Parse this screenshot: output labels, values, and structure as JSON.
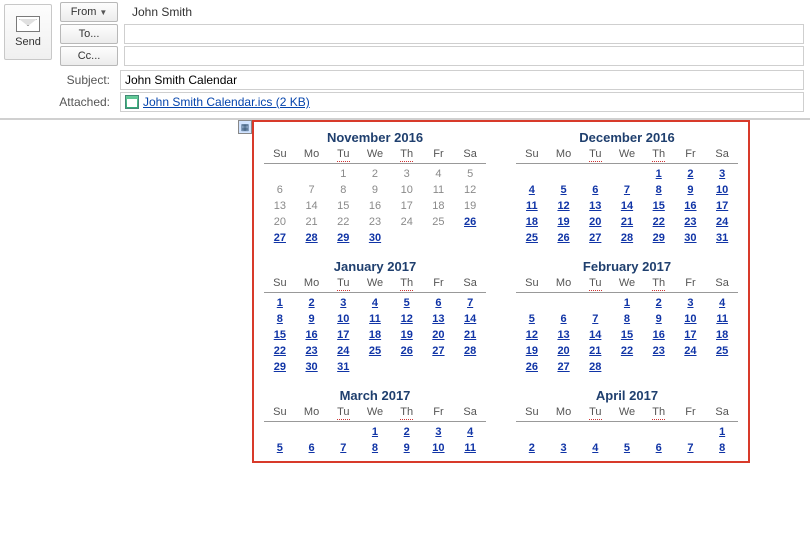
{
  "compose": {
    "send_label": "Send",
    "from_label": "From",
    "from_value": "John Smith",
    "to_label": "To...",
    "to_value": "",
    "cc_label": "Cc...",
    "cc_value": "",
    "subject_label": "Subject:",
    "subject_value": "John Smith Calendar",
    "attached_label": "Attached:",
    "attachment_text": "John Smith Calendar.ics (2 KB)"
  },
  "dow": [
    "Su",
    "Mo",
    "Tu",
    "We",
    "Th",
    "Fr",
    "Sa"
  ],
  "dow_squiggle_idx": [
    2,
    4
  ],
  "months": [
    {
      "title": "November 2016",
      "weeks": [
        [
          "",
          "",
          "1",
          "2",
          "3",
          "4",
          "5"
        ],
        [
          "6",
          "7",
          "8",
          "9",
          "10",
          "11",
          "12"
        ],
        [
          "13",
          "14",
          "15",
          "16",
          "17",
          "18",
          "19"
        ],
        [
          "20",
          "21",
          "22",
          "23",
          "24",
          "25",
          "26"
        ],
        [
          "27",
          "28",
          "29",
          "30",
          "",
          "",
          ""
        ]
      ],
      "linked": [
        "26",
        "27",
        "28",
        "29",
        "30"
      ]
    },
    {
      "title": "December 2016",
      "weeks": [
        [
          "",
          "",
          "",
          "",
          "1",
          "2",
          "3"
        ],
        [
          "4",
          "5",
          "6",
          "7",
          "8",
          "9",
          "10"
        ],
        [
          "11",
          "12",
          "13",
          "14",
          "15",
          "16",
          "17"
        ],
        [
          "18",
          "19",
          "20",
          "21",
          "22",
          "23",
          "24"
        ],
        [
          "25",
          "26",
          "27",
          "28",
          "29",
          "30",
          "31"
        ]
      ],
      "linked": "all"
    },
    {
      "title": "January 2017",
      "weeks": [
        [
          "1",
          "2",
          "3",
          "4",
          "5",
          "6",
          "7"
        ],
        [
          "8",
          "9",
          "10",
          "11",
          "12",
          "13",
          "14"
        ],
        [
          "15",
          "16",
          "17",
          "18",
          "19",
          "20",
          "21"
        ],
        [
          "22",
          "23",
          "24",
          "25",
          "26",
          "27",
          "28"
        ],
        [
          "29",
          "30",
          "31",
          "",
          "",
          "",
          ""
        ]
      ],
      "linked": "all"
    },
    {
      "title": "February 2017",
      "weeks": [
        [
          "",
          "",
          "",
          "1",
          "2",
          "3",
          "4"
        ],
        [
          "5",
          "6",
          "7",
          "8",
          "9",
          "10",
          "11"
        ],
        [
          "12",
          "13",
          "14",
          "15",
          "16",
          "17",
          "18"
        ],
        [
          "19",
          "20",
          "21",
          "22",
          "23",
          "24",
          "25"
        ],
        [
          "26",
          "27",
          "28",
          "",
          "",
          "",
          ""
        ]
      ],
      "linked": "all"
    },
    {
      "title": "March 2017",
      "weeks": [
        [
          "",
          "",
          "",
          "1",
          "2",
          "3",
          "4"
        ],
        [
          "5",
          "6",
          "7",
          "8",
          "9",
          "10",
          "11"
        ]
      ],
      "linked": "all"
    },
    {
      "title": "April 2017",
      "weeks": [
        [
          "",
          "",
          "",
          "",
          "",
          "",
          "1"
        ],
        [
          "2",
          "3",
          "4",
          "5",
          "6",
          "7",
          "8"
        ]
      ],
      "linked": "all"
    }
  ]
}
